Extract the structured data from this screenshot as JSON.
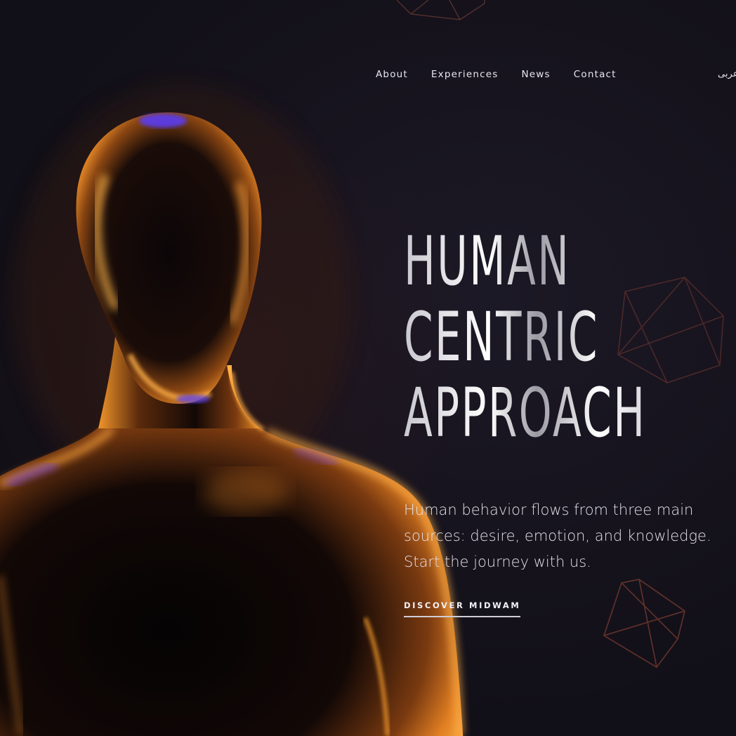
{
  "nav": {
    "items": [
      {
        "label": "About"
      },
      {
        "label": "Experiences"
      },
      {
        "label": "News"
      },
      {
        "label": "Contact"
      }
    ],
    "language_label": "عربی"
  },
  "hero": {
    "headline_lines": [
      "HUMAN",
      "CENTRIC",
      "APPROACH"
    ],
    "description": "Human behavior flows from three main sources: desire, emotion, and knowledge. Start the journey with us.",
    "cta_label": "DISCOVER MIDWAM"
  },
  "colors": {
    "background": "#17141f",
    "figure_glow": "#f39a2c",
    "figure_rim": "#6a3cff",
    "text": "#ffffff"
  }
}
